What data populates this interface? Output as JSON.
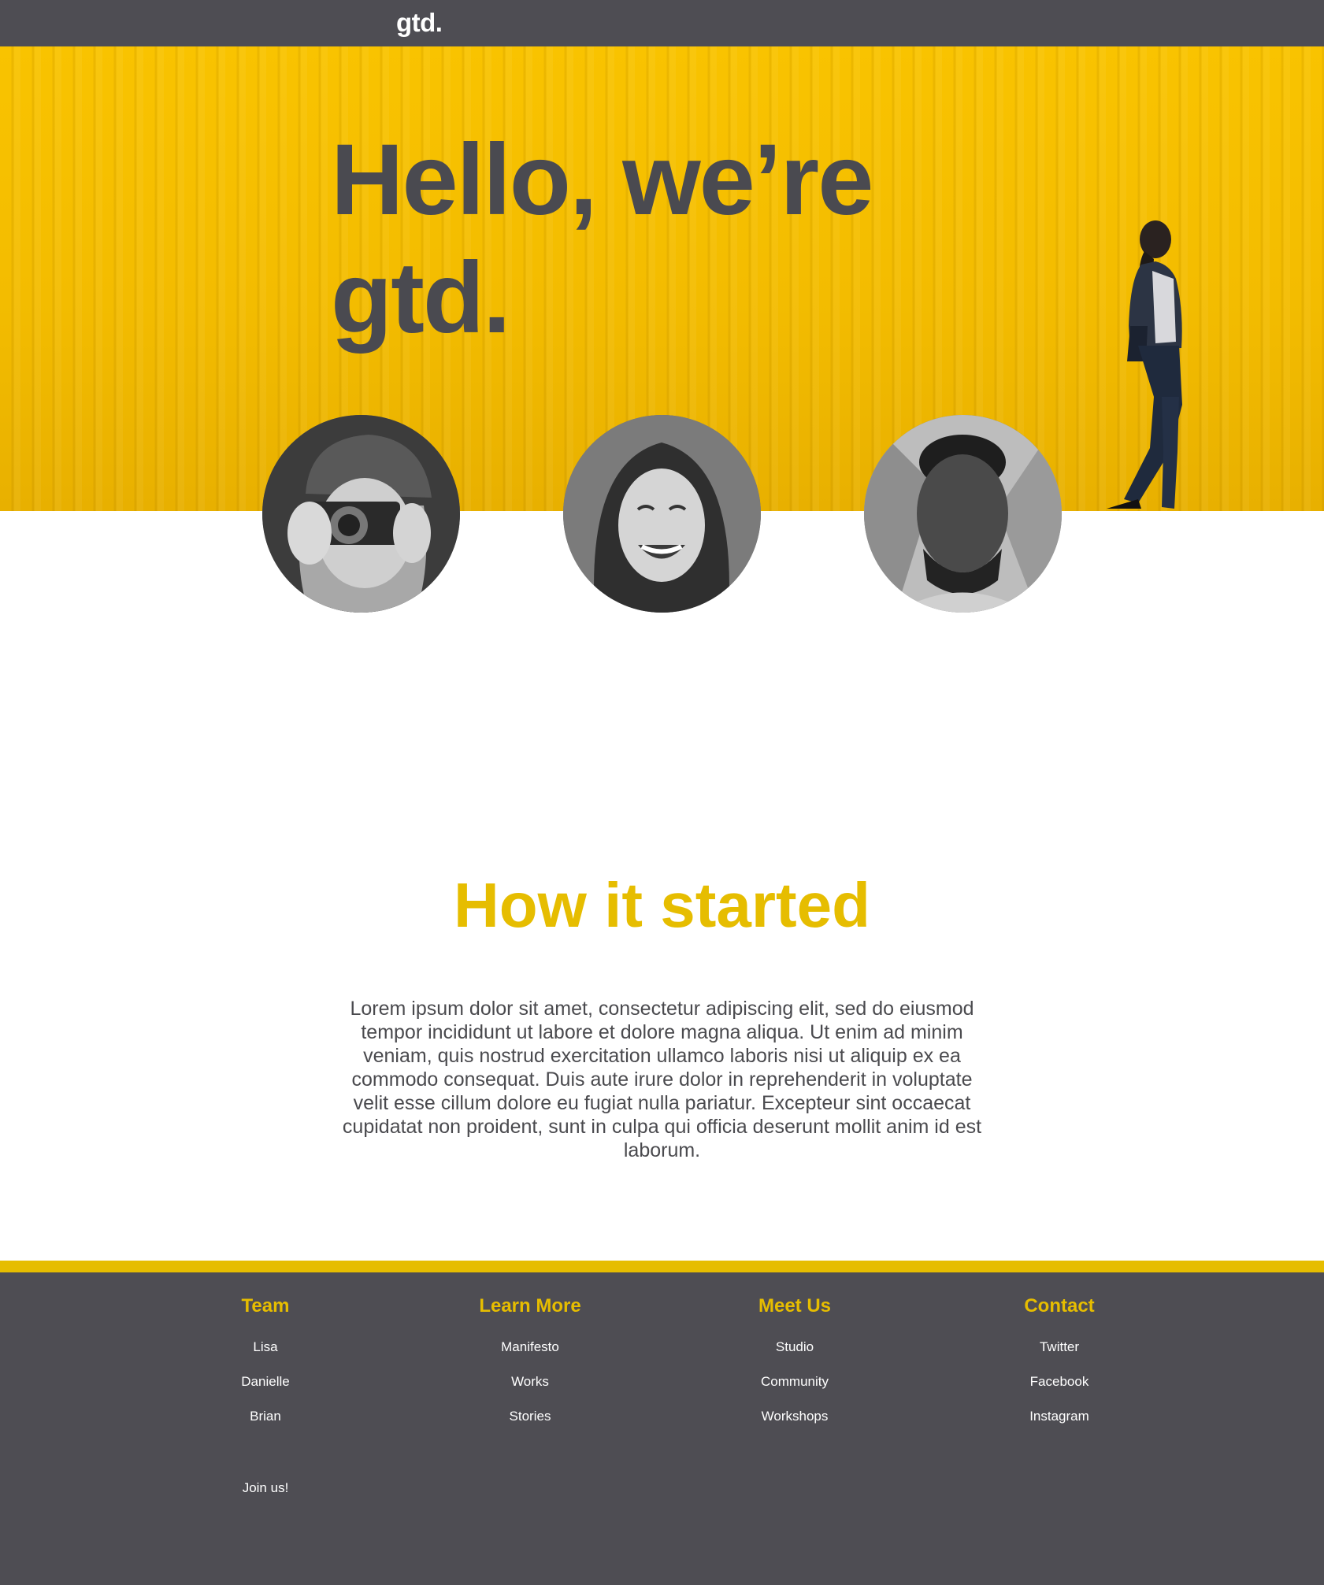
{
  "header": {
    "logo": "gtd."
  },
  "hero": {
    "title_line1": "Hello, we’re",
    "title_line2": "gtd."
  },
  "team_photos": [
    {
      "description": "photographer-avatar"
    },
    {
      "description": "laughing-woman-avatar"
    },
    {
      "description": "man-avatar"
    }
  ],
  "story": {
    "title": "How it started",
    "body": "Lorem ipsum dolor sit amet, consectetur adipiscing elit, sed do eiusmod tempor incididunt ut labore et dolore magna aliqua. Ut enim ad minim veniam, quis nostrud exercitation ullamco laboris nisi ut aliquip ex ea commodo consequat. Duis aute irure dolor in reprehenderit in voluptate velit esse cillum dolore eu fugiat nulla pariatur. Excepteur sint occaecat cupidatat non proident, sunt in culpa qui officia deserunt mollit anim id est laborum."
  },
  "footer": {
    "team": {
      "title": "Team",
      "links": [
        "Lisa",
        "Danielle",
        "Brian"
      ],
      "extra": "Join us!"
    },
    "learn_more": {
      "title": "Learn More",
      "links": [
        "Manifesto",
        "Works",
        "Stories"
      ]
    },
    "meet_us": {
      "title": "Meet Us",
      "links": [
        "Studio",
        "Community",
        "Workshops"
      ]
    },
    "contact": {
      "title": "Contact",
      "links": [
        "Twitter",
        "Facebook",
        "Instagram"
      ]
    }
  },
  "colors": {
    "accent": "#e6bd00",
    "dark": "#4e4d53",
    "hero_yellow": "#f9c300"
  }
}
